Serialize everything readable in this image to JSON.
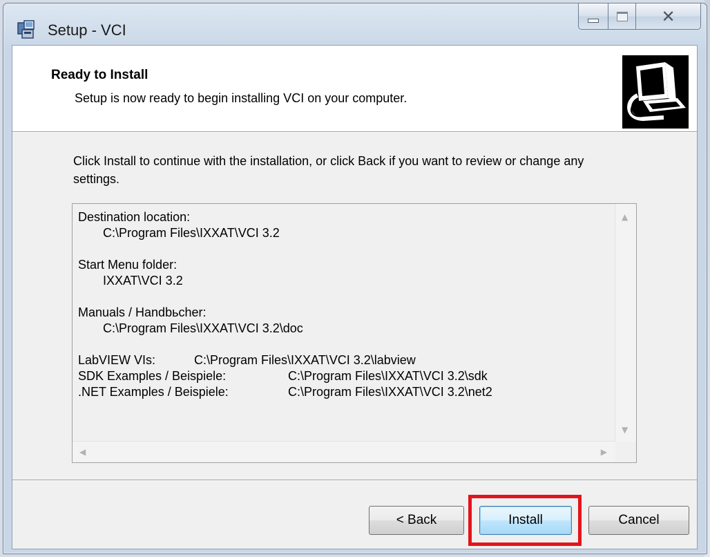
{
  "window": {
    "title": "Setup - VCI",
    "caption": {
      "minimize": "minimize",
      "maximize": "maximize",
      "close": "close"
    }
  },
  "header": {
    "title": "Ready to Install",
    "subtitle": "Setup is now ready to begin installing VCI on your computer."
  },
  "body": {
    "instructions": "Click Install to continue with the installation, or click Back if you want to review or change any settings."
  },
  "memo": {
    "destination_label": "Destination location:",
    "destination_value": "C:\\Program Files\\IXXAT\\VCI 3.2",
    "start_menu_label": "Start Menu folder:",
    "start_menu_value": "IXXAT\\VCI 3.2",
    "manuals_label": "Manuals / Handbьcher:",
    "manuals_value": "C:\\Program Files\\IXXAT\\VCI 3.2\\doc",
    "labview_label": "LabVIEW VIs:",
    "labview_value": "C:\\Program Files\\IXXAT\\VCI 3.2\\labview",
    "sdk_label": "SDK Examples / Beispiele:",
    "sdk_value": "C:\\Program Files\\IXXAT\\VCI 3.2\\sdk",
    "net_label": ".NET Examples / Beispiele:",
    "net_value": "C:\\Program Files\\IXXAT\\VCI 3.2\\net2"
  },
  "buttons": {
    "back": "< Back",
    "install": "Install",
    "cancel": "Cancel"
  },
  "colors": {
    "highlight": "#e3141c",
    "install_border": "#3c7fb1"
  },
  "icons": {
    "title": "setup-installer-icon",
    "wizard": "computer-install-icon"
  }
}
